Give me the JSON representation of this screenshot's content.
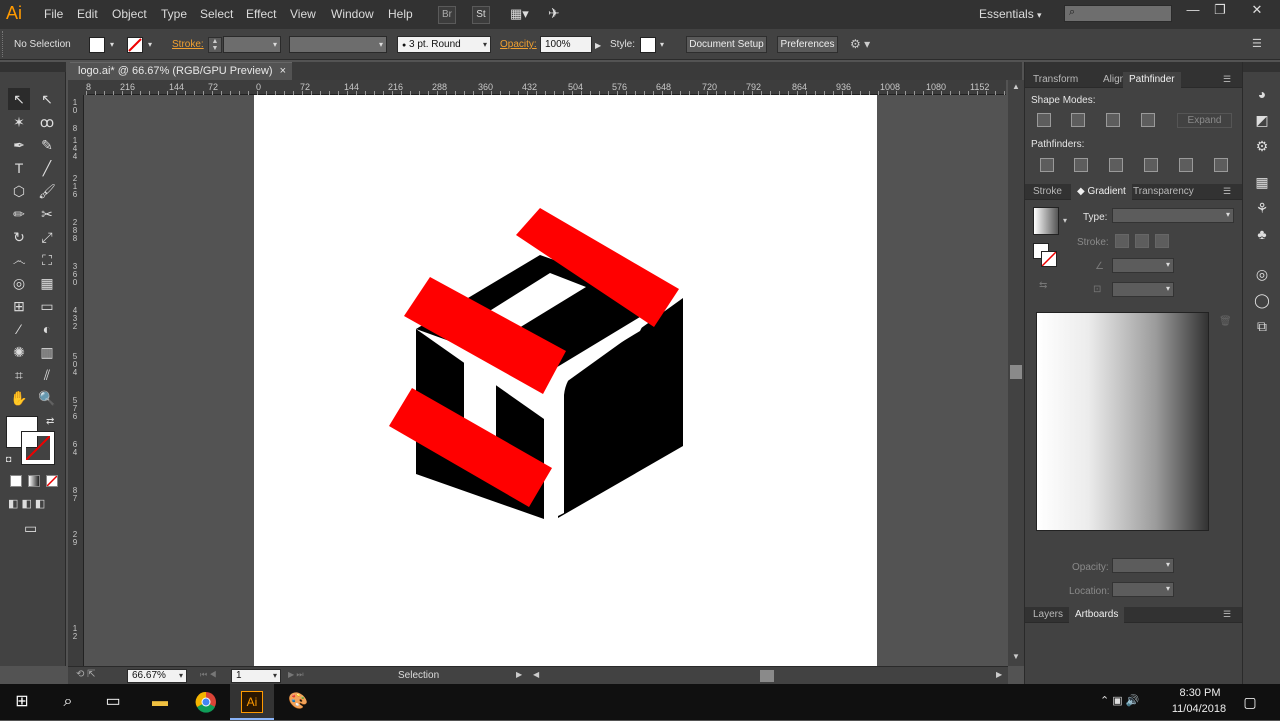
{
  "app": {
    "logo": "Ai",
    "workspace": "Essentials",
    "workspace_arrow": "▾"
  },
  "menu": [
    "File",
    "Edit",
    "Object",
    "Type",
    "Select",
    "Effect",
    "View",
    "Window",
    "Help"
  ],
  "menubar_buttons": {
    "bridge": "Br",
    "stock": "St"
  },
  "control": {
    "selection": "No Selection",
    "stroke_label": "Stroke:",
    "brush": "3 pt. Round",
    "opacity_label": "Opacity:",
    "opacity_value": "100%",
    "style_label": "Style:",
    "document_setup": "Document Setup",
    "preferences": "Preferences"
  },
  "document": {
    "tab": "logo.ai* @ 66.67% (RGB/GPU Preview)",
    "close": "×"
  },
  "ruler_h": [
    "8",
    "216",
    "144",
    "72",
    "0",
    "72",
    "144",
    "216",
    "288",
    "360",
    "432",
    "504",
    "576",
    "648",
    "720",
    "792",
    "864",
    "936",
    "1008",
    "1080",
    "1152"
  ],
  "ruler_v": [
    "1",
    "0",
    "8",
    "1",
    "4",
    "4",
    "2",
    "1",
    "6",
    "2",
    "8",
    "8",
    "3",
    "6",
    "0",
    "4",
    "3",
    "2",
    "5",
    "0",
    "4",
    "5",
    "7",
    "6",
    "6",
    "4",
    "8",
    "7",
    "2",
    "9",
    "1",
    "2"
  ],
  "status": {
    "zoom": "66.67%",
    "artboard_number": "1",
    "tool": "Selection"
  },
  "panels": {
    "top_tabs": [
      "Transform",
      "Align",
      "Pathfinder"
    ],
    "shape_modes_label": "Shape Modes:",
    "expand": "Expand",
    "pathfinders_label": "Pathfinders:",
    "mid_tabs": [
      "Stroke",
      "Gradient",
      "Transparency"
    ],
    "type_label": "Type:",
    "stroke_label": "Stroke:",
    "opacity_label": "Opacity:",
    "location_label": "Location:",
    "bottom_tabs": [
      "Layers",
      "Artboards"
    ]
  },
  "taskbar": {
    "time": "8:30 PM",
    "date": "11/04/2018"
  },
  "colors": {
    "logo_red": "#ff0000",
    "logo_black": "#000000",
    "ai_orange": "#ff9a00"
  }
}
